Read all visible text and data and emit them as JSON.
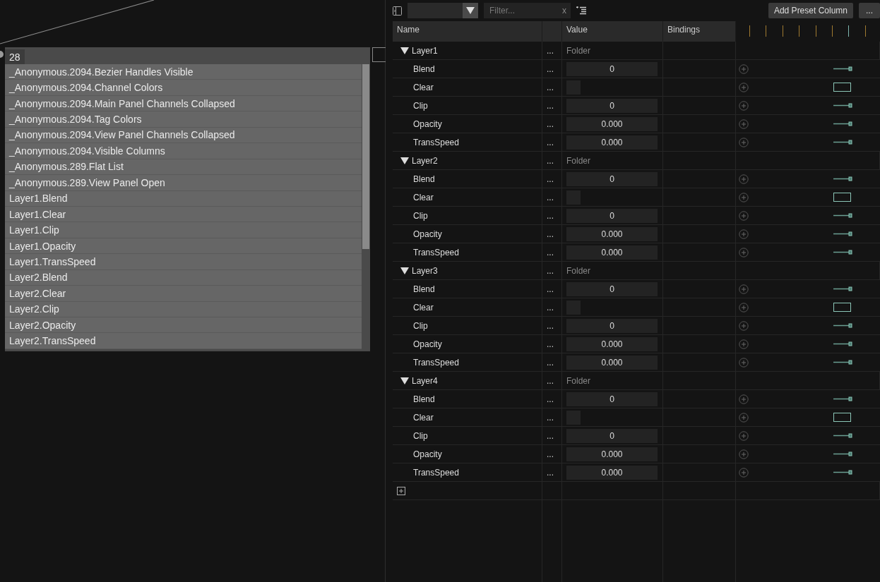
{
  "node": {
    "title": "28",
    "items": [
      "_Anonymous.2094.Bezier Handles Visible",
      "_Anonymous.2094.Channel Colors",
      "_Anonymous.2094.Main Panel Channels Collapsed",
      "_Anonymous.2094.Tag Colors",
      "_Anonymous.2094.View Panel Channels Collapsed",
      "_Anonymous.2094.Visible Columns",
      "_Anonymous.289.Flat List",
      "_Anonymous.289.View Panel Open",
      "Layer1.Blend",
      "Layer1.Clear",
      "Layer1.Clip",
      "Layer1.Opacity",
      "Layer1.TransSpeed",
      "Layer2.Blend",
      "Layer2.Clear",
      "Layer2.Clip",
      "Layer2.Opacity",
      "Layer2.TransSpeed"
    ]
  },
  "toolbar": {
    "filter_placeholder": "Filter...",
    "clear_label": "x",
    "add_preset_button": "Add Preset Column",
    "more_button": "..."
  },
  "table": {
    "columns": [
      "Name",
      "Value",
      "Bindings"
    ],
    "markers": [
      {
        "color": "#a07a30"
      },
      {
        "color": "#a07a30"
      },
      {
        "color": "#a07a30"
      },
      {
        "color": "#a07a30"
      },
      {
        "color": "#a07a30"
      },
      {
        "color": "#a07a30"
      },
      {
        "color": "#7fb8b0"
      },
      {
        "color": "#a07a30"
      }
    ],
    "folders": [
      {
        "name": "Layer1",
        "menu": "...",
        "value": "Folder",
        "expanded": true,
        "children": [
          {
            "name": "Blend",
            "menu": "...",
            "kind": "number",
            "value": "0"
          },
          {
            "name": "Clear",
            "menu": "...",
            "kind": "toggle",
            "checked": false
          },
          {
            "name": "Clip",
            "menu": "...",
            "kind": "number",
            "value": "0"
          },
          {
            "name": "Opacity",
            "menu": "...",
            "kind": "number",
            "value": "0.000"
          },
          {
            "name": "TransSpeed",
            "menu": "...",
            "kind": "number",
            "value": "0.000"
          }
        ]
      },
      {
        "name": "Layer2",
        "menu": "...",
        "value": "Folder",
        "expanded": true,
        "children": [
          {
            "name": "Blend",
            "menu": "...",
            "kind": "number",
            "value": "0"
          },
          {
            "name": "Clear",
            "menu": "...",
            "kind": "toggle",
            "checked": false
          },
          {
            "name": "Clip",
            "menu": "...",
            "kind": "number",
            "value": "0"
          },
          {
            "name": "Opacity",
            "menu": "...",
            "kind": "number",
            "value": "0.000"
          },
          {
            "name": "TransSpeed",
            "menu": "...",
            "kind": "number",
            "value": "0.000"
          }
        ]
      },
      {
        "name": "Layer3",
        "menu": "...",
        "value": "Folder",
        "expanded": true,
        "children": [
          {
            "name": "Blend",
            "menu": "...",
            "kind": "number",
            "value": "0"
          },
          {
            "name": "Clear",
            "menu": "...",
            "kind": "toggle",
            "checked": false
          },
          {
            "name": "Clip",
            "menu": "...",
            "kind": "number",
            "value": "0"
          },
          {
            "name": "Opacity",
            "menu": "...",
            "kind": "number",
            "value": "0.000"
          },
          {
            "name": "TransSpeed",
            "menu": "...",
            "kind": "number",
            "value": "0.000"
          }
        ]
      },
      {
        "name": "Layer4",
        "menu": "...",
        "value": "Folder",
        "expanded": true,
        "children": [
          {
            "name": "Blend",
            "menu": "...",
            "kind": "number",
            "value": "0"
          },
          {
            "name": "Clear",
            "menu": "...",
            "kind": "toggle",
            "checked": false
          },
          {
            "name": "Clip",
            "menu": "...",
            "kind": "number",
            "value": "0"
          },
          {
            "name": "Opacity",
            "menu": "...",
            "kind": "number",
            "value": "0.000"
          },
          {
            "name": "TransSpeed",
            "menu": "...",
            "kind": "number",
            "value": "0.000"
          }
        ]
      }
    ]
  }
}
